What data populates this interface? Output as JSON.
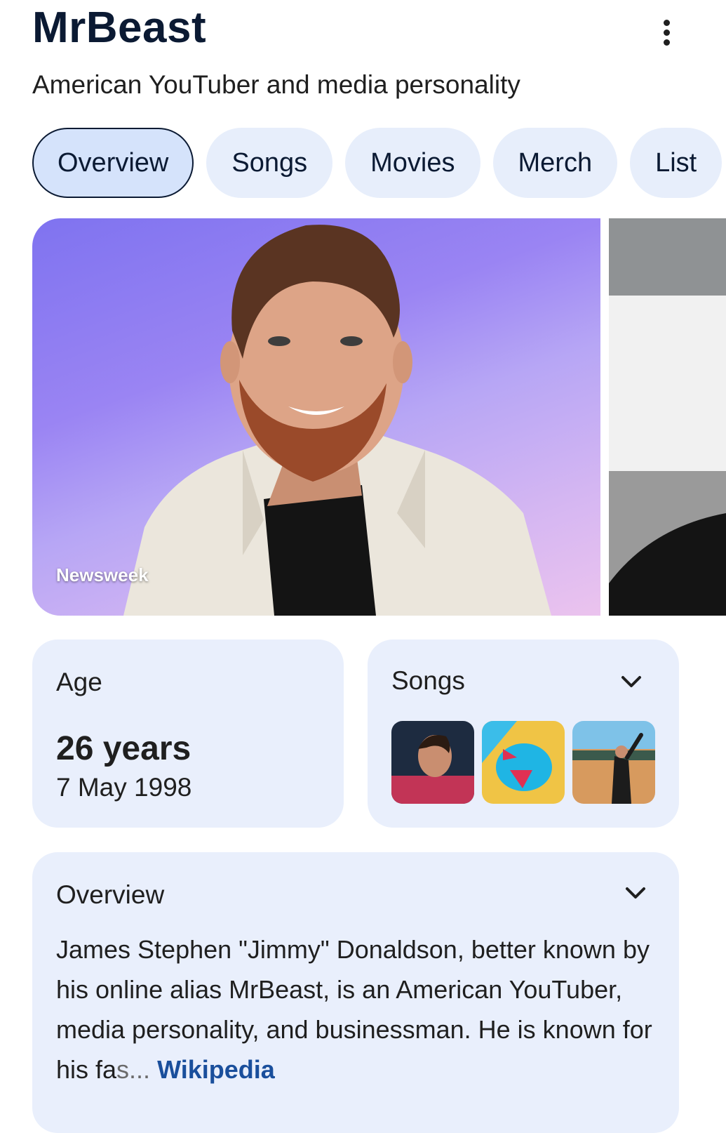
{
  "header": {
    "title": "MrBeast",
    "subtitle": "American YouTuber and media personality",
    "more_icon": "more-vert-icon"
  },
  "tabs": [
    {
      "label": "Overview",
      "active": true
    },
    {
      "label": "Songs",
      "active": false
    },
    {
      "label": "Movies",
      "active": false
    },
    {
      "label": "Merch",
      "active": false
    },
    {
      "label": "List",
      "active": false
    }
  ],
  "images": {
    "main_source": "Newsweek"
  },
  "age_card": {
    "label": "Age",
    "value": "26 years",
    "date": "7 May 1998"
  },
  "songs_card": {
    "label": "Songs",
    "expand_icon": "chevron-down-icon"
  },
  "overview_card": {
    "label": "Overview",
    "expand_icon": "chevron-down-icon",
    "text": "James Stephen \"Jimmy\" Donaldson, better known by his online alias MrBeast, is an American YouTuber, media personality, and businessman. He is known for his fa",
    "fade_text": "s...",
    "link_text": "Wikipedia"
  },
  "colors": {
    "card_bg": "#e9effc",
    "active_tab_bg": "#d5e3fb",
    "link": "#1a4f9c",
    "title": "#0b1a33"
  }
}
